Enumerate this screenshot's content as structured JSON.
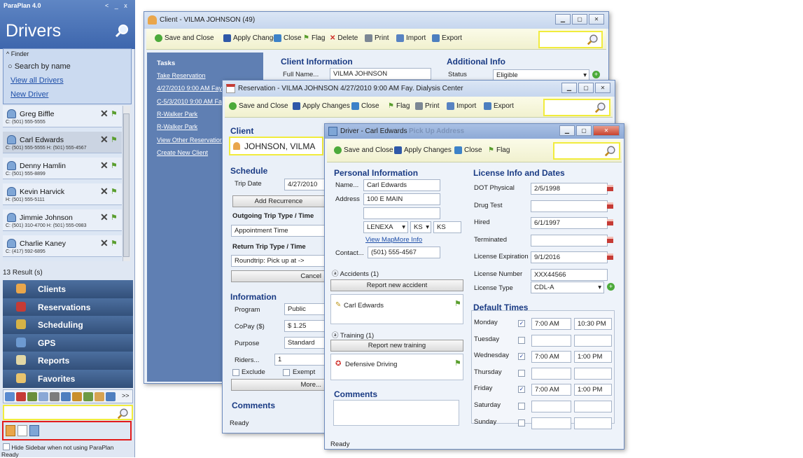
{
  "sidebar": {
    "app_title": "ParaPlan 4.0",
    "window_controls": "< _ x",
    "title": "Drivers",
    "finder": {
      "label": "Finder",
      "search_by_name": "Search by name",
      "view_all": "View all Drivers",
      "new_driver": "New Driver"
    },
    "drivers": [
      {
        "name": "Greg Biffle",
        "phones": "C: (501) 555-5555"
      },
      {
        "name": "Carl Edwards",
        "phones": "C: (501) 555-5555  H: (501) 555-4567"
      },
      {
        "name": "Denny Hamlin",
        "phones": "C: (501) 555-8899"
      },
      {
        "name": "Kevin Harvick",
        "phones": "H: (501) 555-5111"
      },
      {
        "name": "Jimmie Johnson",
        "phones": "C: (501) 310-4700  H: (501) 555-0983"
      },
      {
        "name": "Charlie Kaney",
        "phones": "C: (417) 592-6895"
      }
    ],
    "results": "13 Result (s)",
    "nav": [
      "Clients",
      "Reservations",
      "Scheduling",
      "GPS",
      "Reports",
      "Favorites"
    ],
    "iconbar_more": ">>",
    "hide_sidebar": "Hide Sidebar when not using ParaPlan",
    "status": "Ready"
  },
  "client_window": {
    "title": "Client - VILMA JOHNSON (49)",
    "toolbar": {
      "save_close": "Save and Close",
      "apply": "Apply Changes",
      "close": "Close",
      "flag": "Flag",
      "delete": "Delete",
      "print": "Print",
      "import": "Import",
      "export": "Export"
    },
    "tasks": {
      "header": "Tasks",
      "items": [
        "Take Reservation",
        "4/27/2010 9:00 AM Fay.",
        "C-5/3/2010 9:00 AM Fay",
        "R-Walker Park",
        "R-Walker Park",
        "View Other Reservations",
        "Create New Client"
      ]
    },
    "client_info": {
      "header": "Client Information",
      "full_name_label": "Full Name...",
      "full_name": "VILMA JOHNSON"
    },
    "additional_info": {
      "header": "Additional Info",
      "status_label": "Status",
      "status": "Eligible"
    }
  },
  "reservation_window": {
    "title": "Reservation - VILMA JOHNSON 4/27/2010 9:00 AM Fay. Dialysis Center",
    "toolbar": {
      "save_close": "Save and Close",
      "apply": "Apply Changes",
      "close": "Close",
      "flag": "Flag",
      "print": "Print",
      "import": "Import",
      "export": "Export"
    },
    "client_header": "Client",
    "client_name": "JOHNSON, VILMA",
    "schedule": {
      "header": "Schedule",
      "trip_date_label": "Trip Date",
      "trip_date": "4/27/2010",
      "add_recurrence": "Add Recurrence",
      "outgoing_label": "Outgoing Trip Type / Time",
      "outgoing": "Appointment Time",
      "return_label": "Return Trip Type / Time",
      "return": "Roundtrip: Pick up at ->",
      "cancel": "Cancel"
    },
    "information": {
      "header": "Information",
      "program_label": "Program",
      "program": "Public",
      "copay_label": "CoPay ($)",
      "copay": "$ 1.25",
      "purpose_label": "Purpose",
      "purpose": "Standard",
      "riders_label": "Riders...",
      "riders": "1",
      "exclude": "Exclude",
      "exempt": "Exempt",
      "more": "More..."
    },
    "comments": "Comments",
    "status": "Ready"
  },
  "driver_window": {
    "title": "Driver - Carl Edwards",
    "ghost_title": "Pick Up Address",
    "toolbar": {
      "save_close": "Save and Close",
      "apply": "Apply Changes",
      "close": "Close",
      "flag": "Flag"
    },
    "personal": {
      "header": "Personal Information",
      "name_label": "Name...",
      "name": "Carl Edwards",
      "address_label": "Address",
      "address1": "100 E MAIN",
      "address2": "",
      "city": "LENEXA",
      "state": "KS",
      "zip": "KS",
      "view_map": "View Map",
      "more_info": "More Info",
      "contact_label": "Contact...",
      "contact": "(501) 555-4567"
    },
    "accidents": {
      "label": "Accidents (1)",
      "report": "Report new accident",
      "item": "Carl Edwards"
    },
    "training": {
      "label": "Training (1)",
      "report": "Report new training",
      "item": "Defensive Driving"
    },
    "comments": "Comments",
    "license": {
      "header": "License Info and Dates",
      "dot_label": "DOT Physical",
      "dot": "2/5/1998",
      "drug_label": "Drug Test",
      "drug": "",
      "hired_label": "Hired",
      "hired": "6/1/1997",
      "terminated_label": "Terminated",
      "terminated": "",
      "exp_label": "License Expiration",
      "exp": "9/1/2016",
      "num_label": "License Number",
      "num": "XXX44566",
      "type_label": "License Type",
      "type": "CDL-A"
    },
    "default_times": {
      "header": "Default Times",
      "days": [
        {
          "day": "Monday",
          "checked": true,
          "start": "7:00 AM",
          "end": "10:30 PM"
        },
        {
          "day": "Tuesday",
          "checked": false,
          "start": "",
          "end": ""
        },
        {
          "day": "Wednesday",
          "checked": true,
          "start": "7:00 AM",
          "end": "1:00 PM"
        },
        {
          "day": "Thursday",
          "checked": false,
          "start": "",
          "end": ""
        },
        {
          "day": "Friday",
          "checked": true,
          "start": "7:00 AM",
          "end": "1:00 PM"
        },
        {
          "day": "Saturday",
          "checked": false,
          "start": "",
          "end": ""
        },
        {
          "day": "Sunday",
          "checked": false,
          "start": "",
          "end": ""
        }
      ]
    },
    "status": "Ready"
  },
  "colors": {
    "accent_yellow": "#f1ec3d",
    "nav_blue": "#3d5f8e",
    "header_blue": "#1a3b84",
    "highlight_red": "#e21b1b"
  }
}
